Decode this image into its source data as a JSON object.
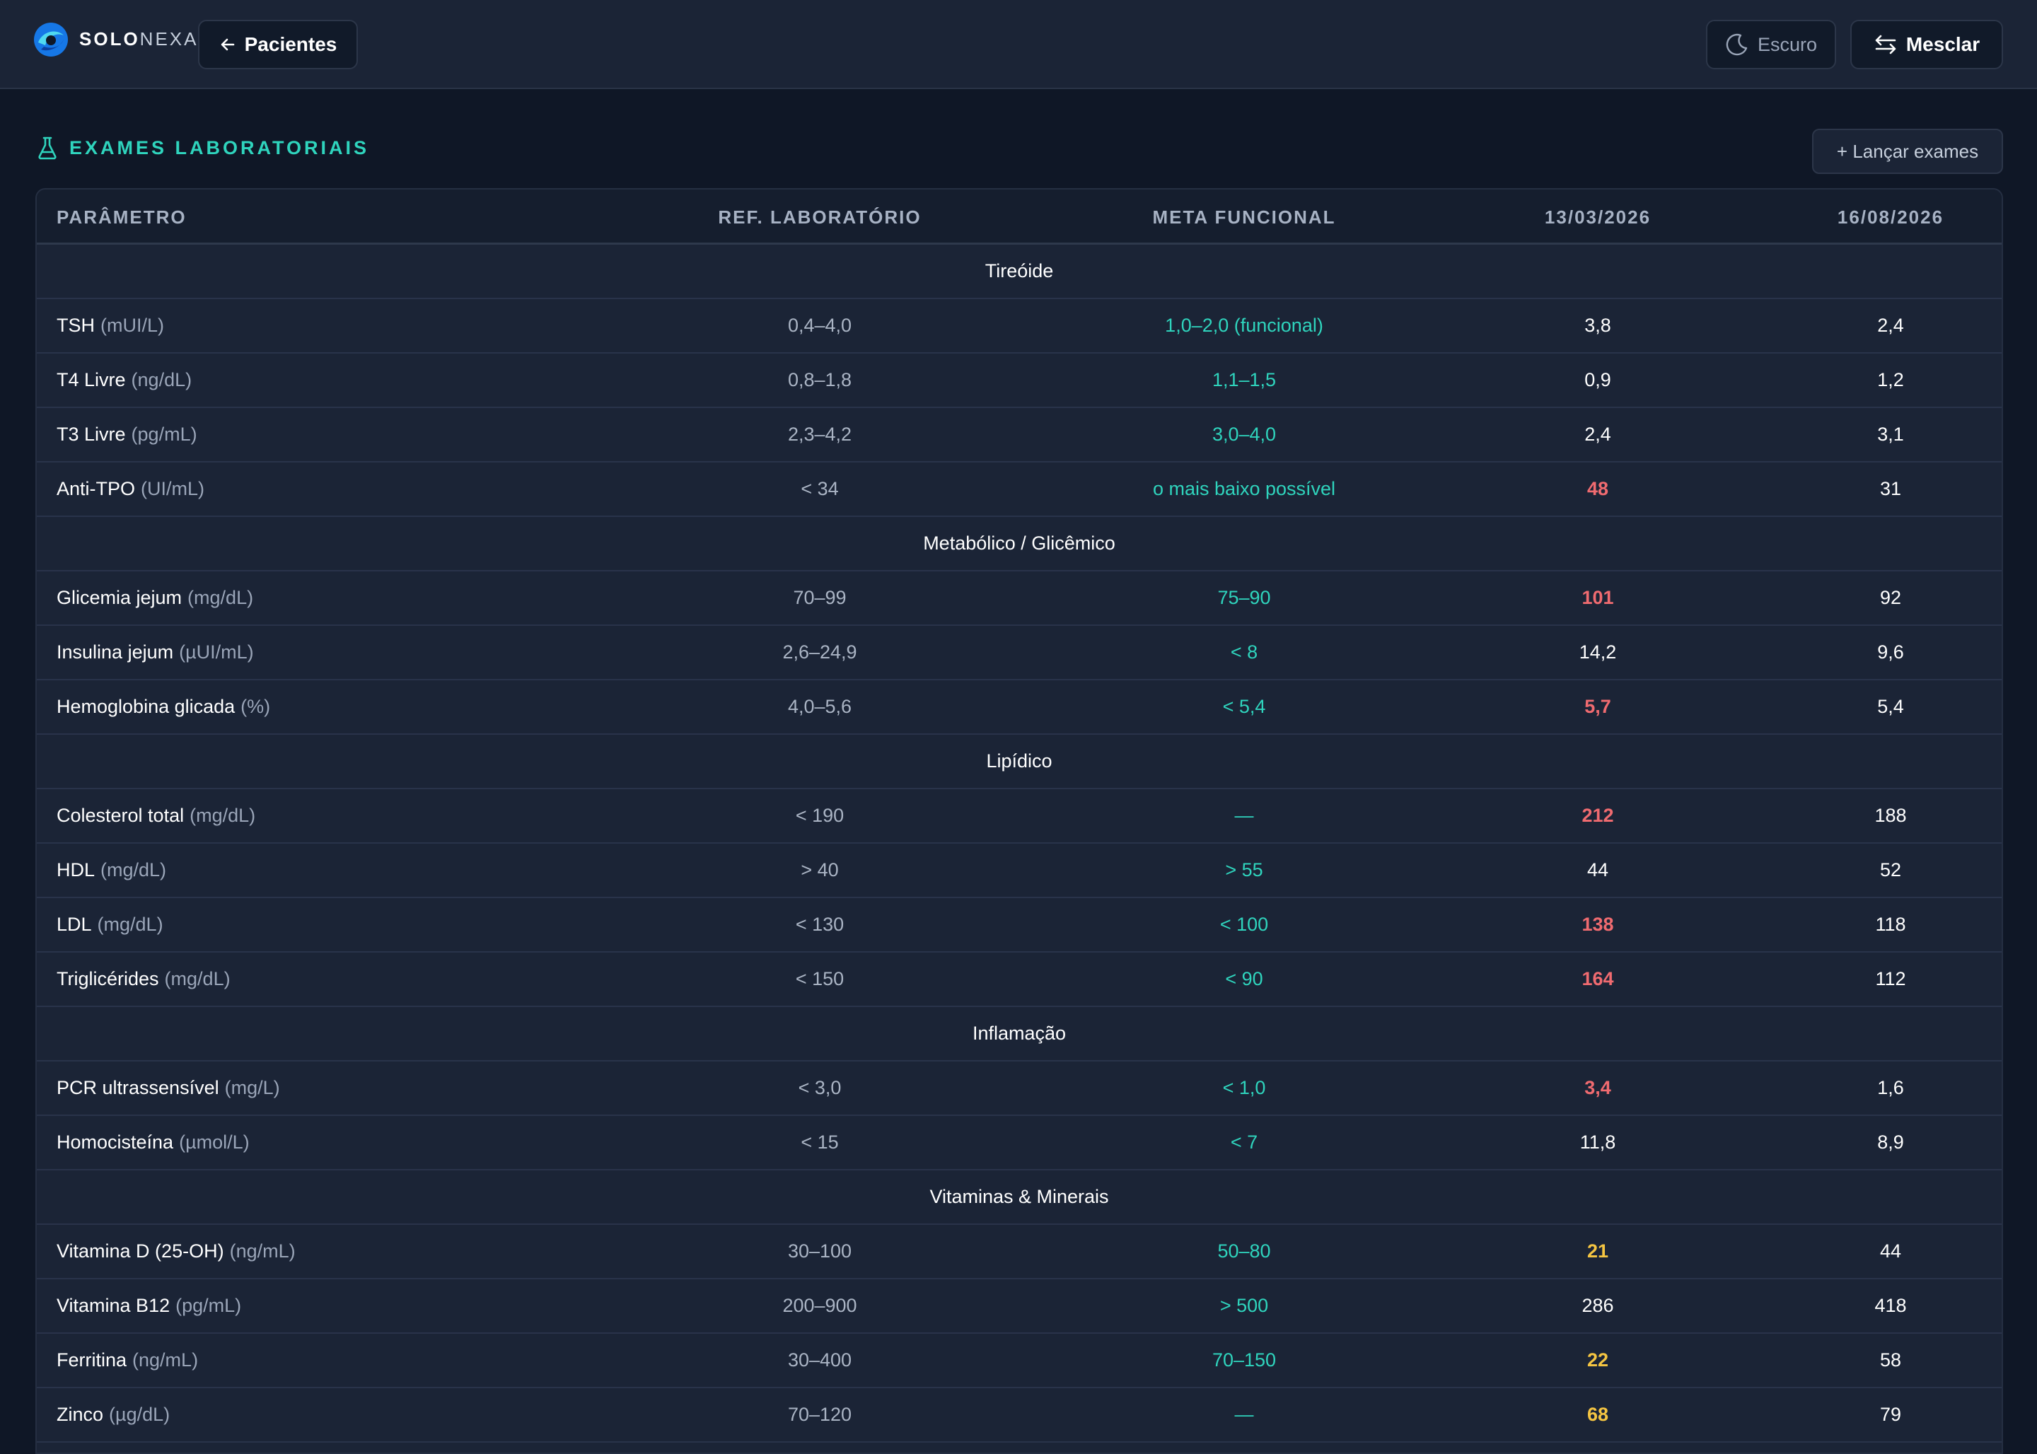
{
  "brand": {
    "bold": "SOLO",
    "light": "NEXA"
  },
  "header": {
    "back_label": "Pacientes",
    "theme_label": "Escuro",
    "merge_label": "Mesclar"
  },
  "section": {
    "title": "EXAMES LABORATORIAIS",
    "launch_label": "+ Lançar exames"
  },
  "table": {
    "columns": [
      "PARÂMETRO",
      "REF. LABORATÓRIO",
      "META FUNCIONAL",
      "13/03/2026",
      "16/08/2026"
    ],
    "rows": [
      {
        "group": "Tireóide"
      },
      {
        "name": "TSH",
        "unit": "(mUI/L)",
        "ref": "0,4–4,0",
        "meta": "1,0–2,0 (funcional)",
        "d1": "3,8",
        "d1_status": "normal",
        "d2": "2,4"
      },
      {
        "name": "T4 Livre",
        "unit": "(ng/dL)",
        "ref": "0,8–1,8",
        "meta": "1,1–1,5",
        "d1": "0,9",
        "d1_status": "normal",
        "d2": "1,2"
      },
      {
        "name": "T3 Livre",
        "unit": "(pg/mL)",
        "ref": "2,3–4,2",
        "meta": "3,0–4,0",
        "d1": "2,4",
        "d1_status": "normal",
        "d2": "3,1"
      },
      {
        "name": "Anti-TPO",
        "unit": "(UI/mL)",
        "ref": "< 34",
        "meta": "o mais baixo possível",
        "d1": "48",
        "d1_status": "high",
        "d2": "31"
      },
      {
        "group": "Metabólico / Glicêmico"
      },
      {
        "name": "Glicemia jejum",
        "unit": "(mg/dL)",
        "ref": "70–99",
        "meta": "75–90",
        "d1": "101",
        "d1_status": "high",
        "d2": "92"
      },
      {
        "name": "Insulina jejum",
        "unit": "(µUI/mL)",
        "ref": "2,6–24,9",
        "meta": "< 8",
        "d1": "14,2",
        "d1_status": "normal",
        "d2": "9,6"
      },
      {
        "name": "Hemoglobina glicada",
        "unit": "(%)",
        "ref": "4,0–5,6",
        "meta": "< 5,4",
        "d1": "5,7",
        "d1_status": "high",
        "d2": "5,4"
      },
      {
        "group": "Lipídico"
      },
      {
        "name": "Colesterol total",
        "unit": "(mg/dL)",
        "ref": "< 190",
        "meta": "—",
        "d1": "212",
        "d1_status": "high",
        "d2": "188"
      },
      {
        "name": "HDL",
        "unit": "(mg/dL)",
        "ref": "> 40",
        "meta": "> 55",
        "d1": "44",
        "d1_status": "normal",
        "d2": "52"
      },
      {
        "name": "LDL",
        "unit": "(mg/dL)",
        "ref": "< 130",
        "meta": "< 100",
        "d1": "138",
        "d1_status": "high",
        "d2": "118"
      },
      {
        "name": "Triglicérides",
        "unit": "(mg/dL)",
        "ref": "< 150",
        "meta": "< 90",
        "d1": "164",
        "d1_status": "high",
        "d2": "112"
      },
      {
        "group": "Inflamação"
      },
      {
        "name": "PCR ultrassensível",
        "unit": "(mg/L)",
        "ref": "< 3,0",
        "meta": "< 1,0",
        "d1": "3,4",
        "d1_status": "high",
        "d2": "1,6"
      },
      {
        "name": "Homocisteína",
        "unit": "(µmol/L)",
        "ref": "< 15",
        "meta": "< 7",
        "d1": "11,8",
        "d1_status": "normal",
        "d2": "8,9"
      },
      {
        "group": "Vitaminas & Minerais"
      },
      {
        "name": "Vitamina D (25-OH)",
        "unit": "(ng/mL)",
        "ref": "30–100",
        "meta": "50–80",
        "d1": "21",
        "d1_status": "low",
        "d2": "44"
      },
      {
        "name": "Vitamina B12",
        "unit": "(pg/mL)",
        "ref": "200–900",
        "meta": "> 500",
        "d1": "286",
        "d1_status": "normal",
        "d2": "418"
      },
      {
        "name": "Ferritina",
        "unit": "(ng/mL)",
        "ref": "30–400",
        "meta": "70–150",
        "d1": "22",
        "d1_status": "low",
        "d2": "58"
      },
      {
        "name": "Zinco",
        "unit": "(µg/dL)",
        "ref": "70–120",
        "meta": "—",
        "d1": "68",
        "d1_status": "low",
        "d2": "79"
      }
    ]
  },
  "colors": {
    "accent": "#2fd4bd",
    "high": "#f06b70",
    "low": "#f5c542",
    "background": "#0f1726",
    "surface": "#1b2436"
  },
  "icons": {
    "logo": "solonexa-logo",
    "back": "arrow-left-icon",
    "theme": "moon-icon",
    "merge": "swap-arrows-icon",
    "section": "flask-icon"
  }
}
